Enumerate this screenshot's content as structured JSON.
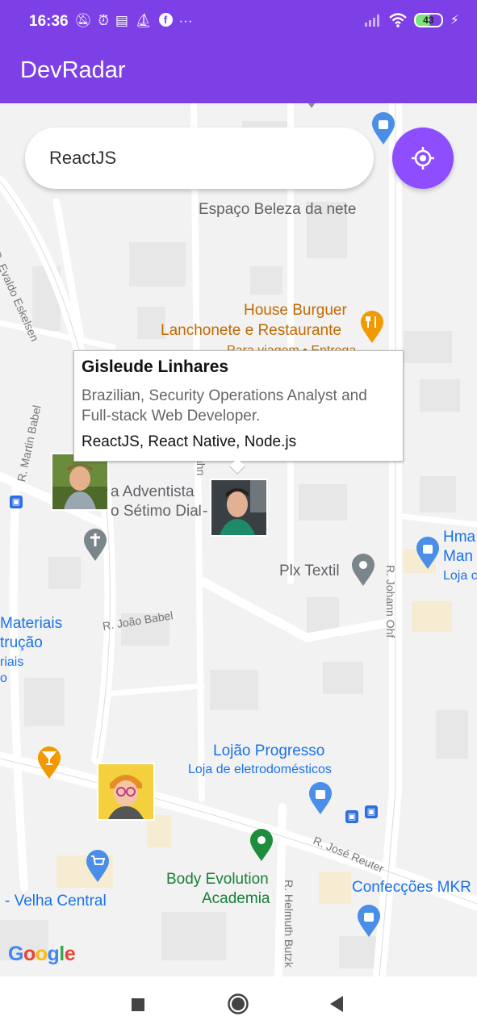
{
  "status": {
    "time": "16:36",
    "left_icons": [
      "silent-bell-icon",
      "alarm-icon",
      "message-icon",
      "boat-icon",
      "facebook-icon",
      "more-icon"
    ],
    "battery": "43"
  },
  "app": {
    "title": "DevRadar"
  },
  "search": {
    "value": "ReactJS",
    "placeholder": ""
  },
  "map": {
    "pois": {
      "espaco": "Espaço Beleza da nete",
      "burger1": "House Burguer",
      "burger2": "Lanchonete e Restaurante",
      "burger3": "Para viagem • Entrega",
      "adventista1": "a Adventista",
      "adventista2": "o Sétimo Dia -",
      "adventista_cut": "I",
      "plx": "Plx Textil",
      "hma1": "Hma",
      "hma2": "Man",
      "hma3": "Loja c",
      "materiais1": "Materiais",
      "materiais2": "trução",
      "materiais3": "riais",
      "materiais4": "o",
      "lojao1": "Lojão Progresso",
      "lojao2": "Loja de eletrodomésticos",
      "body1": "Body Evolution",
      "body2": "Academia",
      "confeccoes": "Confecções MKR",
      "velha": "- Velha Central"
    },
    "streets": {
      "evaldo": "R. Evaldo Eskelsen",
      "martin": "R. Martin Babel",
      "joao": "R. João Babel",
      "johann": "R. Johann Ohf",
      "jose": "R. José Reuter",
      "helmuth": "R. Helmuth Butzk",
      "hahn": "ahn"
    },
    "google_logo": [
      "G",
      "o",
      "o",
      "g",
      "l",
      "e"
    ]
  },
  "callout": {
    "name": "Gisleude Linhares",
    "bio": "Brazilian, Security Operations Analyst and Full-stack Web Developer.",
    "techs": "ReactJS, React Native, Node.js"
  },
  "colors": {
    "primary": "#7d40e7",
    "button": "#8e4dff",
    "poi_orange": "#c26a00",
    "poi_blue": "#1a73e8",
    "poi_green": "#188038",
    "poi_gray": "#5f6368"
  },
  "navbar": {
    "buttons": [
      "recent-apps-icon",
      "home-icon",
      "back-icon"
    ]
  }
}
